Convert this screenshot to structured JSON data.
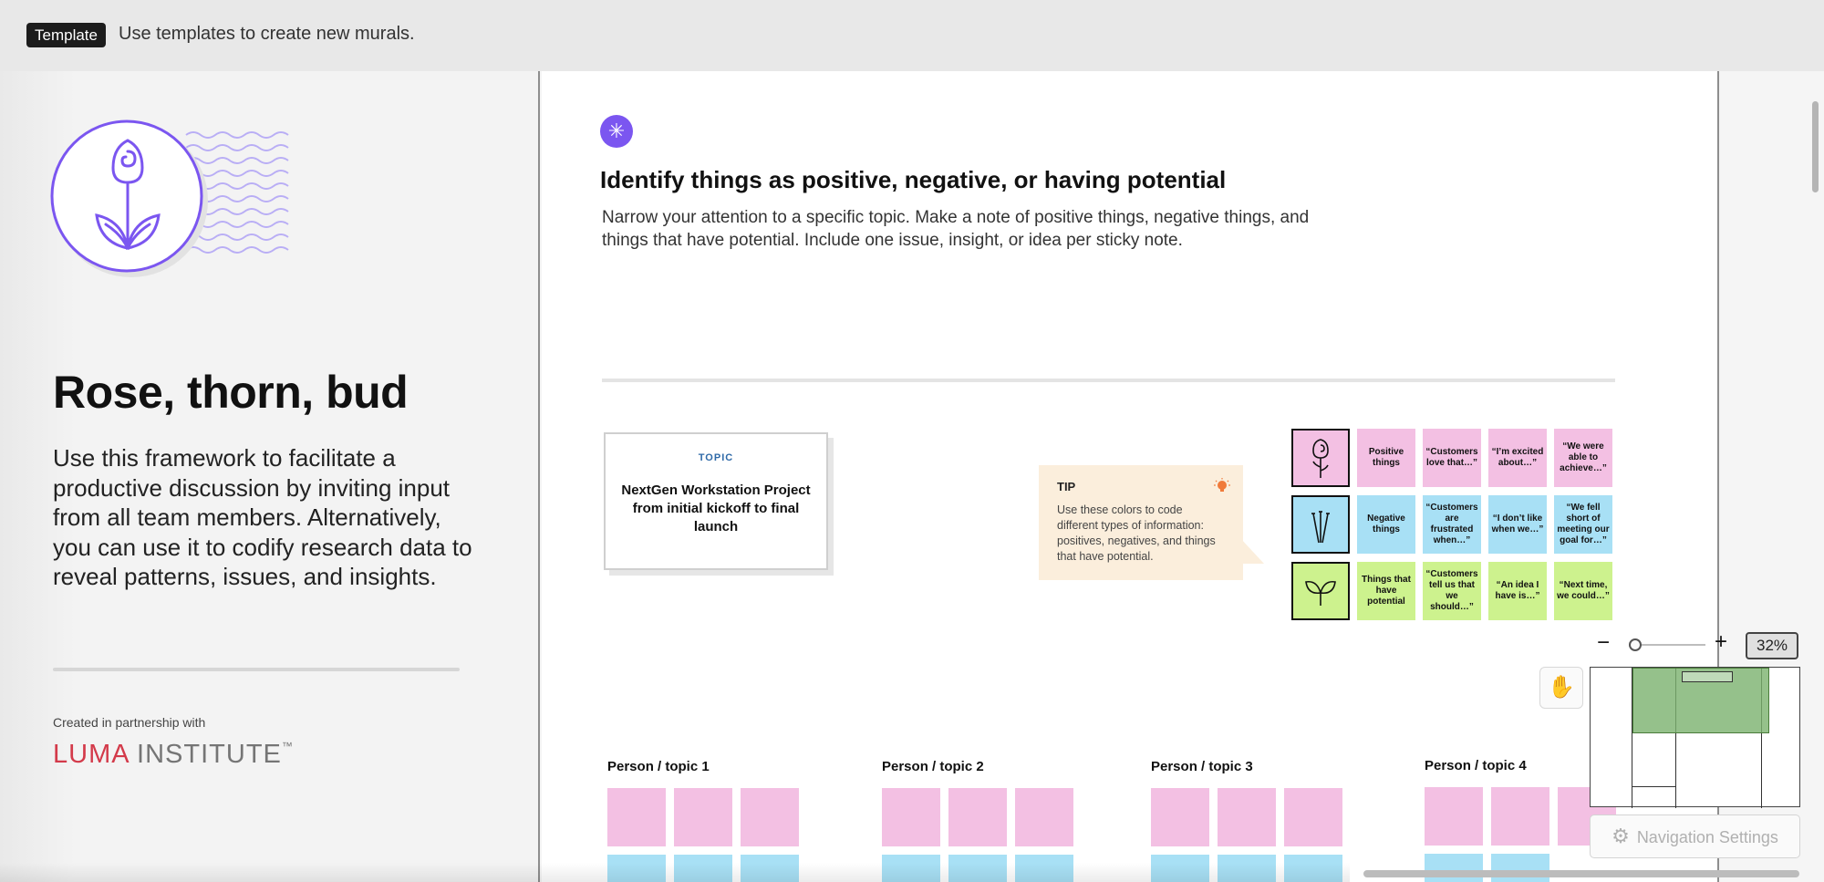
{
  "banner": {
    "badge": "Template",
    "message": "Use templates to create new murals."
  },
  "left": {
    "title": "Rose, thorn, bud",
    "description": "Use this framework to facilitate a productive discussion by inviting input from all team members. Alternatively, you can use it to codify research data to reveal patterns, issues, and insights.",
    "partner_text": "Created in partnership with",
    "partner_logo_a": "LU",
    "partner_logo_b": "MA",
    "partner_logo_c": " INSTITUTE",
    "partner_logo_tm": "™"
  },
  "main": {
    "headline": "Identify things as positive, negative, or having potential",
    "subtext": "Narrow your attention to a specific topic. Make a note of positive things, negative things, and things that have potential. Include one issue, insight, or idea per sticky note.",
    "topic": {
      "label": "TOPIC",
      "text": "NextGen Workstation Project from initial kickoff to final launch"
    },
    "tip": {
      "title": "TIP",
      "text": "Use these colors to code different types of information: positives, negatives, and things that have potential."
    },
    "legend": {
      "rows": [
        {
          "icon": "rose-icon",
          "color": "#f3c0e3",
          "cells": [
            "Positive things",
            "“Customers love that…”",
            "“I’m excited about…”",
            "“We were able to achieve…”"
          ]
        },
        {
          "icon": "thorn-icon",
          "color": "#a8e0f5",
          "cells": [
            "Negative things",
            "“Customers are frustrated when…”",
            "“I don’t like when we…”",
            "“We fell short of meeting our goal for…”"
          ]
        },
        {
          "icon": "bud-icon",
          "color": "#cdf28e",
          "cells": [
            "Things that have potential",
            "“Customers tell us that we should…”",
            "“An idea I have is…”",
            "“Next time, we could…”"
          ]
        }
      ]
    },
    "persons": [
      "Person / topic 1",
      "Person / topic 2",
      "Person / topic 3",
      "Person / topic 4"
    ]
  },
  "controls": {
    "zoom_minus": "−",
    "zoom_plus": "+",
    "zoom_level": "32%",
    "nav_settings": "Navigation Settings"
  },
  "colors": {
    "accent": "#7b56f0",
    "pink": "#f3c0e3",
    "blue": "#a8e0f5",
    "green": "#cdf28e"
  }
}
